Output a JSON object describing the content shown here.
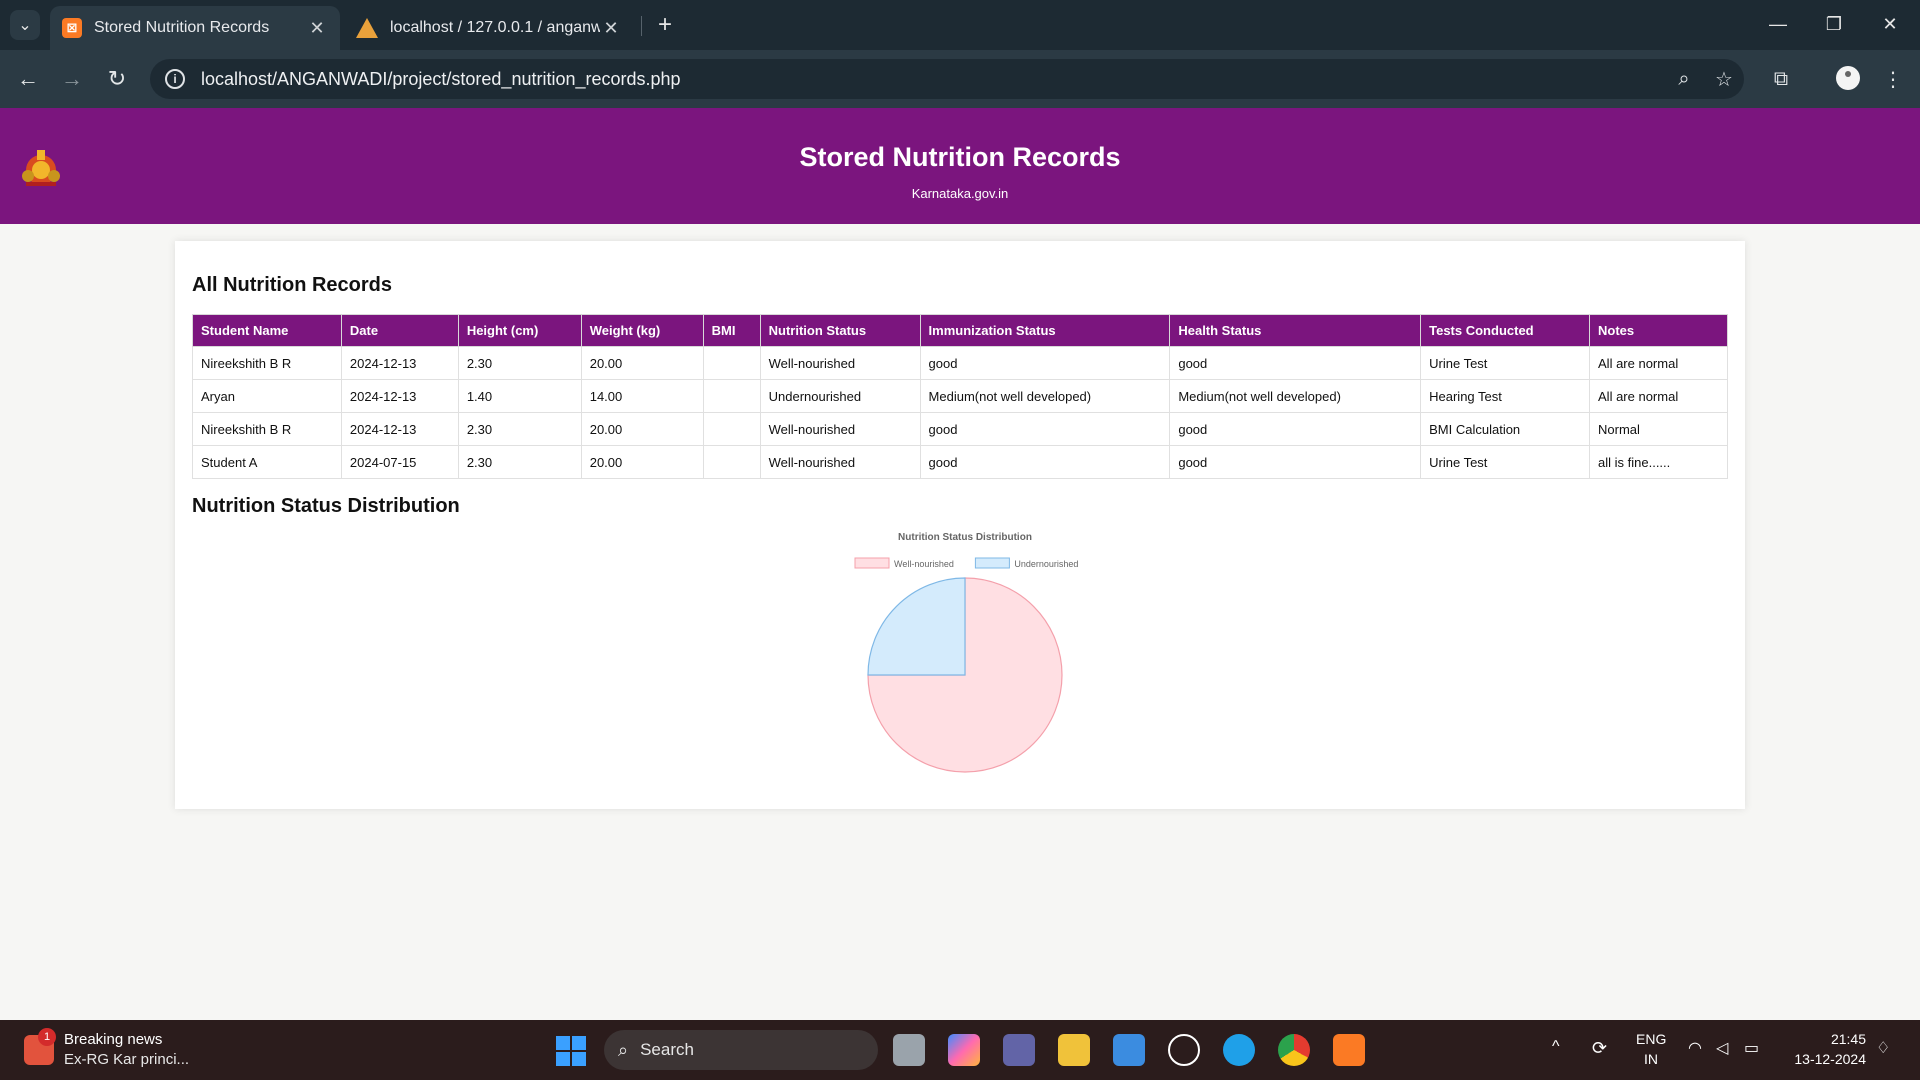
{
  "browser": {
    "tabs": [
      {
        "title": "Stored Nutrition Records",
        "active": true
      },
      {
        "title": "localhost / 127.0.0.1 / anganwa",
        "active": false
      }
    ],
    "url": "localhost/ANGANWADI/project/stored_nutrition_records.php"
  },
  "header": {
    "title": "Stored Nutrition Records",
    "subtitle": "Karnataka.gov.in"
  },
  "records": {
    "heading": "All Nutrition Records",
    "columns": [
      "Student Name",
      "Date",
      "Height (cm)",
      "Weight (kg)",
      "BMI",
      "Nutrition Status",
      "Immunization Status",
      "Health Status",
      "Tests Conducted",
      "Notes"
    ],
    "rows": [
      [
        "Nireekshith B R",
        "2024-12-13",
        "2.30",
        "20.00",
        "",
        "Well-nourished",
        "good",
        "good",
        "Urine Test",
        "All are normal"
      ],
      [
        "Aryan",
        "2024-12-13",
        "1.40",
        "14.00",
        "",
        "Undernourished",
        "Medium(not well developed)",
        "Medium(not well developed)",
        "Hearing Test",
        "All are normal"
      ],
      [
        "Nireekshith B R",
        "2024-12-13",
        "2.30",
        "20.00",
        "",
        "Well-nourished",
        "good",
        "good",
        "BMI Calculation",
        "Normal"
      ],
      [
        "Student A",
        "2024-07-15",
        "2.30",
        "20.00",
        "",
        "Well-nourished",
        "good",
        "good",
        "Urine Test",
        "all is fine......"
      ]
    ]
  },
  "distribution": {
    "heading": "Nutrition Status Distribution"
  },
  "chart_data": {
    "type": "pie",
    "title": "Nutrition Status Distribution",
    "categories": [
      "Well-nourished",
      "Undernourished"
    ],
    "values": [
      3,
      1
    ],
    "colors": [
      "#ffdfe3",
      "#d4ebfc"
    ],
    "border_colors": [
      "#f4a0ab",
      "#7fb8e6"
    ],
    "legend_position": "top"
  },
  "taskbar": {
    "news_title": "Breaking news",
    "news_sub": "Ex-RG Kar princi...",
    "news_badge": "1",
    "search_label": "Search",
    "lang_top": "ENG",
    "lang_bottom": "IN",
    "time": "21:45",
    "date": "13-12-2024"
  }
}
